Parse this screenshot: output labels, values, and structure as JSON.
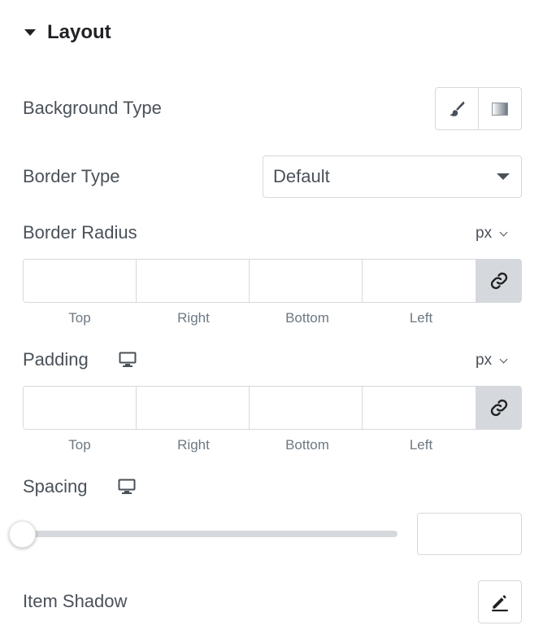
{
  "section": {
    "title": "Layout",
    "icon": "caret-down-icon"
  },
  "background_type": {
    "label": "Background Type",
    "options": [
      {
        "name": "classic",
        "icon": "paint-brush-icon"
      },
      {
        "name": "gradient",
        "icon": "gradient-icon"
      }
    ]
  },
  "border_type": {
    "label": "Border Type",
    "selected": "Default"
  },
  "border_radius": {
    "label": "Border Radius",
    "unit": "px",
    "fields": [
      "Top",
      "Right",
      "Bottom",
      "Left"
    ],
    "values": [
      "",
      "",
      "",
      ""
    ],
    "link_icon": "link-icon"
  },
  "padding": {
    "label": "Padding",
    "device_icon": "desktop-icon",
    "unit": "px",
    "fields": [
      "Top",
      "Right",
      "Bottom",
      "Left"
    ],
    "values": [
      "",
      "",
      "",
      ""
    ],
    "link_icon": "link-icon"
  },
  "spacing": {
    "label": "Spacing",
    "device_icon": "desktop-icon",
    "slider_value_fraction": 0,
    "value": ""
  },
  "item_shadow": {
    "label": "Item Shadow",
    "edit_icon": "pencil-icon"
  },
  "colors": {
    "text": "#4a5159",
    "border": "#d5d8dc",
    "heading": "#1f2124",
    "muted": "#6d7882"
  }
}
